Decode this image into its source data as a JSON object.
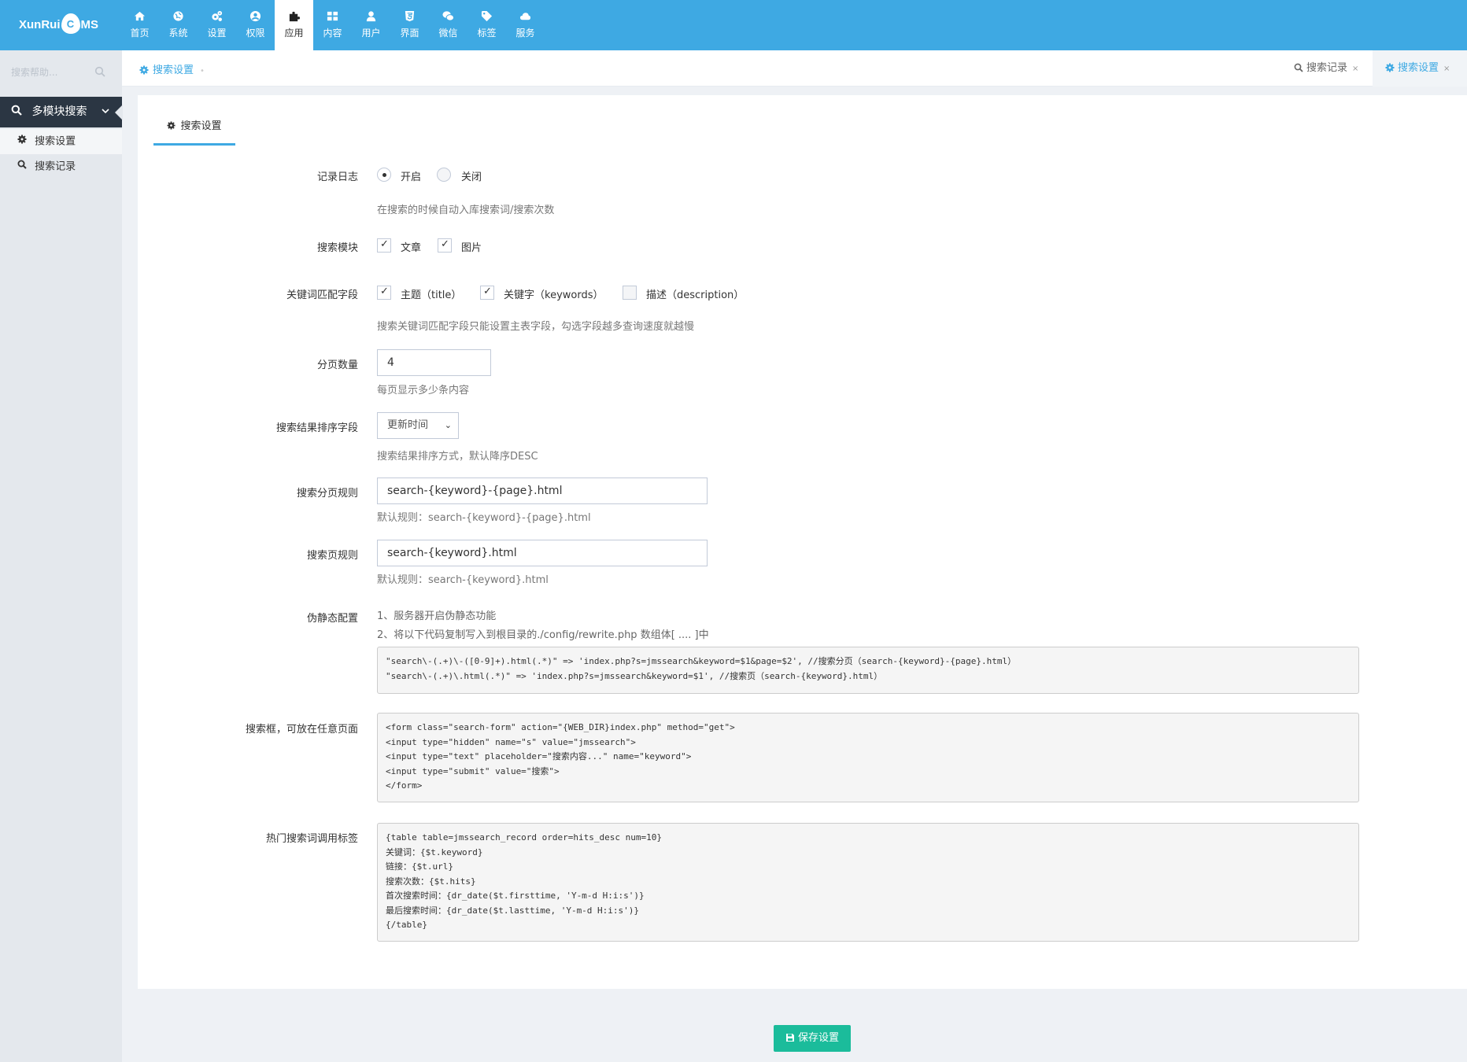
{
  "brand": {
    "logo_part1": "XunRui",
    "logo_drop": "C",
    "logo_part2": "MS"
  },
  "nav": [
    {
      "label": "首页",
      "icon": "home-icon"
    },
    {
      "label": "系统",
      "icon": "globe-icon"
    },
    {
      "label": "设置",
      "icon": "cogs-icon"
    },
    {
      "label": "权限",
      "icon": "user-circle-icon"
    },
    {
      "label": "应用",
      "icon": "puzzle-icon",
      "active": true
    },
    {
      "label": "内容",
      "icon": "grid-icon"
    },
    {
      "label": "用户",
      "icon": "user-icon"
    },
    {
      "label": "界面",
      "icon": "html5-icon"
    },
    {
      "label": "微信",
      "icon": "wechat-icon"
    },
    {
      "label": "标签",
      "icon": "tag-icon"
    },
    {
      "label": "服务",
      "icon": "cloud-icon"
    }
  ],
  "sidebar": {
    "search_placeholder": "搜索帮助...",
    "group_label": "多模块搜索",
    "items": [
      {
        "label": "搜索设置",
        "icon": "gear-icon",
        "active": true
      },
      {
        "label": "搜索记录",
        "icon": "search-icon"
      }
    ]
  },
  "tabbar": {
    "crumb": "搜索设置",
    "tabs": [
      {
        "label": "搜索记录",
        "icon": "search-icon",
        "close": "×"
      },
      {
        "label": "搜索设置",
        "icon": "gear-icon",
        "close": "×",
        "active": true
      }
    ]
  },
  "form": {
    "tab_label": "搜索设置",
    "log": {
      "label": "记录日志",
      "options": [
        "开启",
        "关闭"
      ],
      "selected": "开启",
      "help": "在搜索的时候自动入库搜索词/搜索次数"
    },
    "modules": {
      "label": "搜索模块",
      "options": [
        {
          "label": "文章",
          "checked": true
        },
        {
          "label": "图片",
          "checked": true
        }
      ]
    },
    "fields": {
      "label": "关键词匹配字段",
      "options": [
        {
          "label": "主题（title）",
          "checked": true
        },
        {
          "label": "关键字（keywords）",
          "checked": true
        },
        {
          "label": "描述（description）",
          "checked": false
        }
      ],
      "help": "搜索关键词匹配字段只能设置主表字段，勾选字段越多查询速度就越慢"
    },
    "pagesize": {
      "label": "分页数量",
      "value": "4",
      "help": "每页显示多少条内容"
    },
    "order": {
      "label": "搜索结果排序字段",
      "value": "更新时间",
      "help": "搜索结果排序方式，默认降序DESC"
    },
    "page_rule": {
      "label": "搜索分页规则",
      "value": "search-{keyword}-{page}.html",
      "help": "默认规则：search-{keyword}-{page}.html"
    },
    "search_rule": {
      "label": "搜索页规则",
      "value": "search-{keyword}.html",
      "help": "默认规则：search-{keyword}.html"
    },
    "rewrite": {
      "label": "伪静态配置",
      "note1": "1、服务器开启伪静态功能",
      "note2": "2、将以下代码复制写入到根目录的./config/rewrite.php 数组体[ .... ]中",
      "code": "\"search\\-(.+)\\-([0-9]+).html(.*)\" => 'index.php?s=jmssearch&keyword=$1&page=$2', //搜索分页（search-{keyword}-{page}.html）\n\"search\\-(.+)\\.html(.*)\" => 'index.php?s=jmssearch&keyword=$1', //搜索页（search-{keyword}.html）"
    },
    "searchbox": {
      "label": "搜索框，可放在任意页面",
      "code": "<form class=\"search-form\" action=\"{WEB_DIR}index.php\" method=\"get\">\n<input type=\"hidden\" name=\"s\" value=\"jmssearch\">\n<input type=\"text\" placeholder=\"搜索内容...\" name=\"keyword\">\n<input type=\"submit\" value=\"搜索\">\n</form>"
    },
    "hot": {
      "label": "热门搜索词调用标签",
      "code": "{table table=jmssearch_record order=hits_desc num=10}\n关键词：{$t.keyword}\n链接：{$t.url}\n搜索次数：{$t.hits}\n首次搜索时间：{dr_date($t.firsttime, 'Y-m-d H:i:s')}\n最后搜索时间：{dr_date($t.lasttime, 'Y-m-d H:i:s')}\n{/table}"
    }
  },
  "footer": {
    "save_label": "保存设置"
  },
  "colors": {
    "accent": "#3ea9e3",
    "save": "#1bbc9b",
    "sidebar_dark": "#2b3643"
  }
}
